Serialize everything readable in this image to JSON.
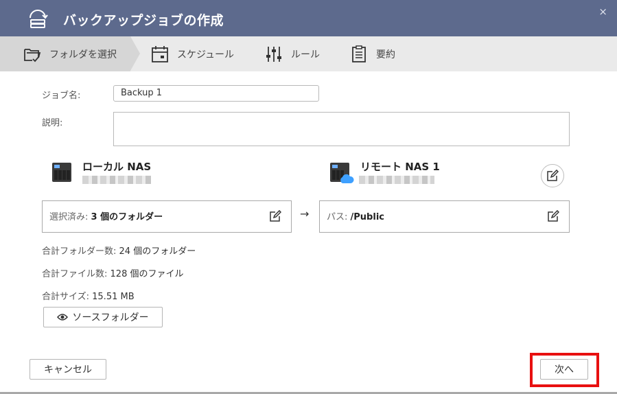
{
  "dialog": {
    "title": "バックアップジョブの作成",
    "close_glyph": "×"
  },
  "steps": [
    {
      "label": "フォルダを選択",
      "icon": "folder-check-icon",
      "active": true
    },
    {
      "label": "スケジュール",
      "icon": "calendar-icon",
      "active": false
    },
    {
      "label": "ルール",
      "icon": "sliders-icon",
      "active": false
    },
    {
      "label": "要約",
      "icon": "clipboard-icon",
      "active": false
    }
  ],
  "form": {
    "job_name_label": "ジョブ名:",
    "job_name_value": "Backup 1",
    "description_label": "説明:",
    "description_value": ""
  },
  "local": {
    "name": "ローカル NAS",
    "selected_prefix": "選択済み:",
    "selected_value": "3 個のフォルダー"
  },
  "remote": {
    "name": "リモート NAS 1",
    "path_prefix": "パス:",
    "path_value": "/Public"
  },
  "arrow_glyph": "→",
  "stats": {
    "folders_label": "合計フォルダー数:",
    "folders_value": "24 個のフォルダー",
    "files_label": "合計ファイル数:",
    "files_value": "128 個のファイル",
    "size_label": "合計サイズ:",
    "size_value": "15.51 MB"
  },
  "buttons": {
    "source_folder": "ソースフォルダー",
    "cancel": "キャンセル",
    "next": "次へ"
  },
  "colors": {
    "titlebar": "#5d6a8d",
    "highlight": "#e81010",
    "cloud": "#3ea0ff"
  }
}
